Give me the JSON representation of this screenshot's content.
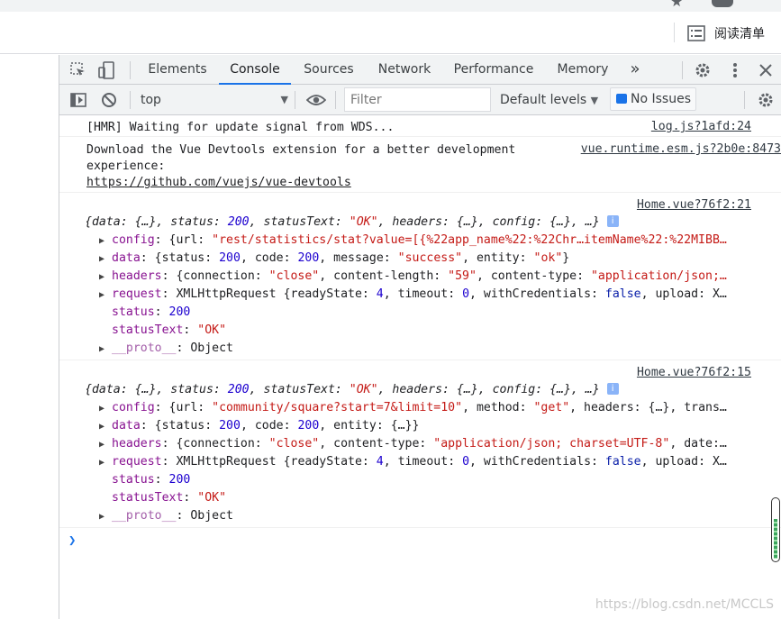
{
  "browser": {
    "reading_list_label": "阅读清单"
  },
  "devtools": {
    "tabs": [
      {
        "label": "Elements"
      },
      {
        "label": "Console"
      },
      {
        "label": "Sources"
      },
      {
        "label": "Network"
      },
      {
        "label": "Performance"
      },
      {
        "label": "Memory"
      }
    ],
    "more_tabs": "»",
    "active_tab": "Console"
  },
  "toolbar": {
    "context": "top",
    "filter_placeholder": "Filter",
    "levels_label": "Default levels",
    "issues_label": "No Issues"
  },
  "messages": {
    "hmr": {
      "text": "[HMR] Waiting for update signal from WDS...",
      "source": "log.js?1afd:24"
    },
    "devtools_hint": {
      "line1": "Download the Vue Devtools extension for a better development",
      "line2": "experience:",
      "link": "https://github.com/vuejs/vue-devtools",
      "source": "vue.runtime.esm.js?2b0e:8473"
    },
    "res1": {
      "source": "Home.vue?76f2:21",
      "summary": {
        "p1": "{data: {…}, status: ",
        "status": "200",
        "p2": ", statusText: ",
        "statusText": "\"OK\"",
        "p3": ", headers: {…}, config: {…}, …}"
      },
      "config": {
        "key": "config",
        "p1": ": {url: ",
        "url": "\"rest/statistics/stat?value=[{%22app_name%22:%22Chr…itemName%22:%22MIBB…"
      },
      "data": {
        "key": "data",
        "p1": ": {status: ",
        "status": "200",
        "p2": ", code: ",
        "code": "200",
        "p3": ", message: ",
        "message": "\"success\"",
        "p4": ", entity: ",
        "entity": "\"ok\"",
        "p5": "}"
      },
      "headers": {
        "key": "headers",
        "p1": ": {connection: ",
        "connection": "\"close\"",
        "p2": ", content-length: ",
        "length": "\"59\"",
        "p3": ", content-type: ",
        "ctype": "\"application/json;…"
      },
      "request": {
        "key": "request",
        "p1": ": ",
        "cls": "XMLHttpRequest",
        "p2": " {readyState: ",
        "ready": "4",
        "p3": ", timeout: ",
        "timeout": "0",
        "p4": ", withCredentials: ",
        "cred": "false",
        "p5": ", upload: X…"
      },
      "status": {
        "key": "status",
        "p1": ": ",
        "val": "200"
      },
      "statusText": {
        "key": "statusText",
        "p1": ": ",
        "val": "\"OK\""
      },
      "proto": {
        "key": "__proto__",
        "p1": ": Object"
      }
    },
    "res2": {
      "source": "Home.vue?76f2:15",
      "summary": {
        "p1": "{data: {…}, status: ",
        "status": "200",
        "p2": ", statusText: ",
        "statusText": "\"OK\"",
        "p3": ", headers: {…}, config: {…}, …}"
      },
      "config": {
        "key": "config",
        "p1": ": {url: ",
        "url": "\"community/square?start=7&limit=10\"",
        "p2": ", method: ",
        "method": "\"get\"",
        "p3": ", headers: {…}, trans…"
      },
      "data": {
        "key": "data",
        "p1": ": {status: ",
        "status": "200",
        "p2": ", code: ",
        "code": "200",
        "p3": ", entity: {…}}"
      },
      "headers": {
        "key": "headers",
        "p1": ": {connection: ",
        "connection": "\"close\"",
        "p2": ", content-type: ",
        "ctype": "\"application/json; charset=UTF-8\"",
        "p3": ", date:…"
      },
      "request": {
        "key": "request",
        "p1": ": ",
        "cls": "XMLHttpRequest",
        "p2": " {readyState: ",
        "ready": "4",
        "p3": ", timeout: ",
        "timeout": "0",
        "p4": ", withCredentials: ",
        "cred": "false",
        "p5": ", upload: X…"
      },
      "status": {
        "key": "status",
        "p1": ": ",
        "val": "200"
      },
      "statusText": {
        "key": "statusText",
        "p1": ": ",
        "val": "\"OK\""
      },
      "proto": {
        "key": "__proto__",
        "p1": ": Object"
      }
    }
  },
  "watermark": "https://blog.csdn.net/MCCLS"
}
